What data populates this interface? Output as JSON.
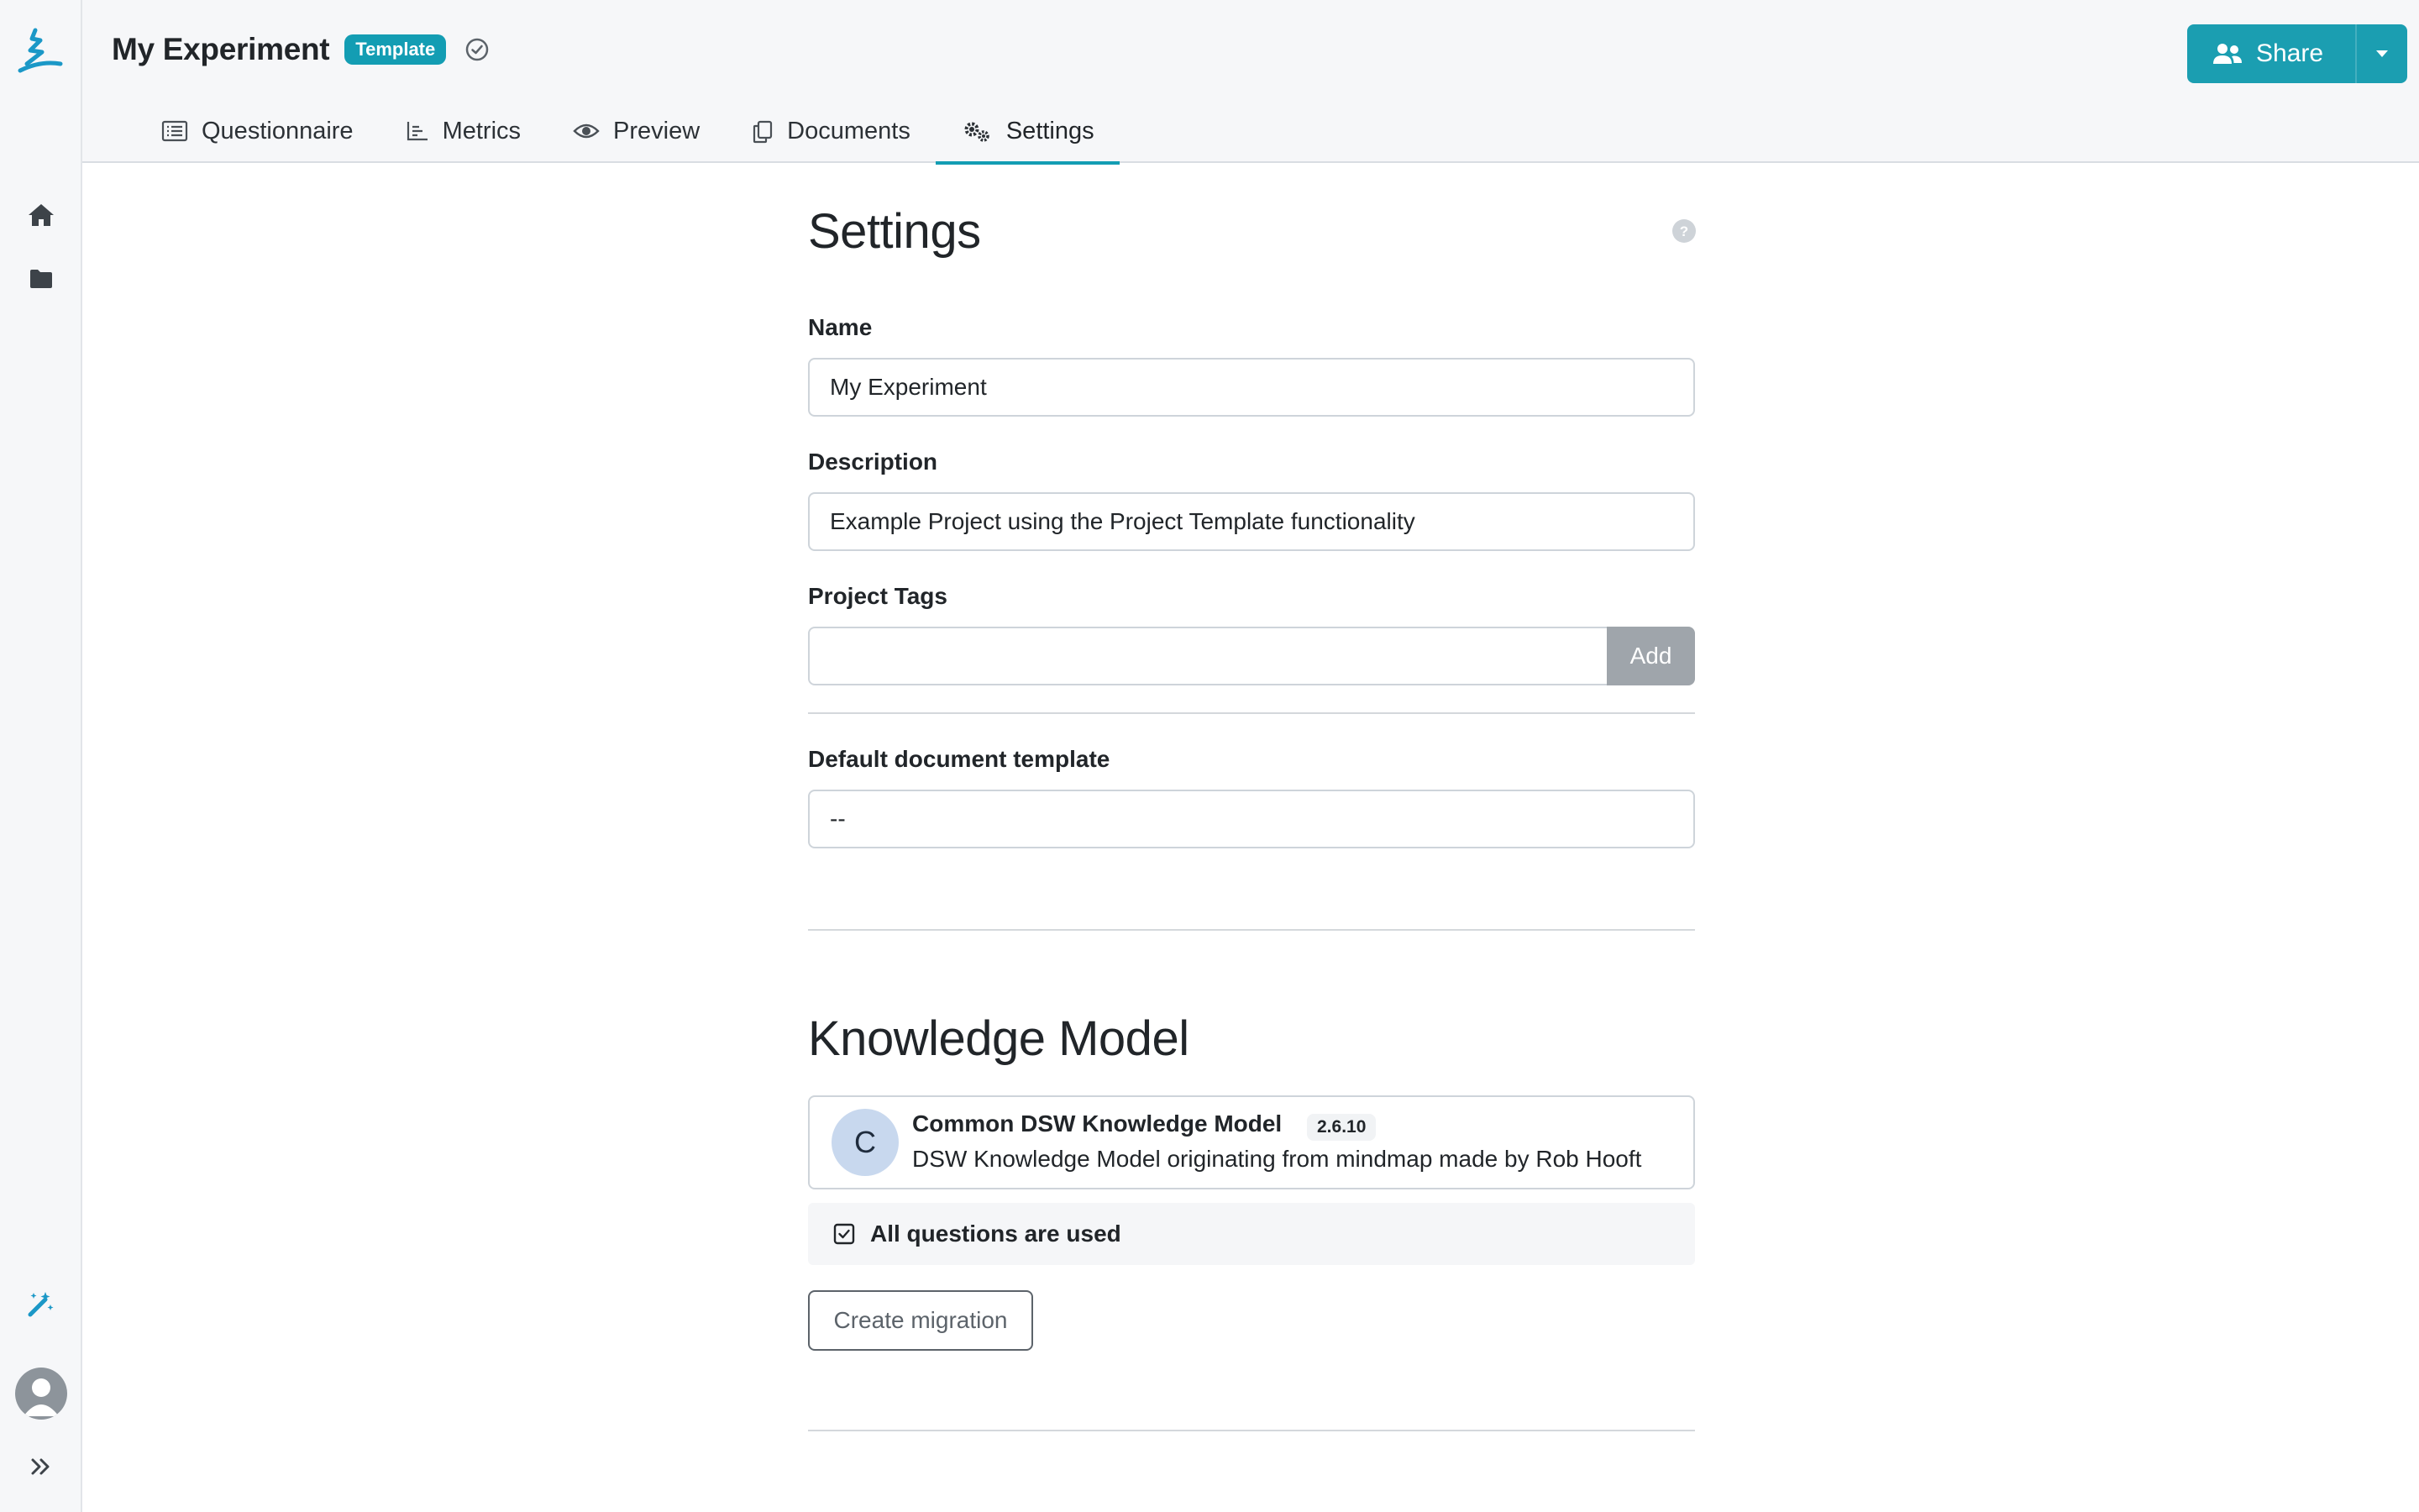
{
  "header": {
    "project_title": "My Experiment",
    "template_badge": "Template",
    "share_label": "Share"
  },
  "tabs": [
    {
      "label": "Questionnaire",
      "icon": "list-icon"
    },
    {
      "label": "Metrics",
      "icon": "bar-chart-icon"
    },
    {
      "label": "Preview",
      "icon": "eye-icon"
    },
    {
      "label": "Documents",
      "icon": "copy-icon"
    },
    {
      "label": "Settings",
      "icon": "gears-icon",
      "active": true
    }
  ],
  "settings": {
    "heading": "Settings",
    "name_label": "Name",
    "name_value": "My Experiment",
    "description_label": "Description",
    "description_value": "Example Project using the Project Template functionality",
    "tags_label": "Project Tags",
    "tags_value": "",
    "add_label": "Add",
    "doc_template_label": "Default document template",
    "doc_template_value": "--"
  },
  "knowledge_model": {
    "heading": "Knowledge Model",
    "avatar_letter": "C",
    "name": "Common DSW Knowledge Model",
    "version": "2.6.10",
    "description": "DSW Knowledge Model originating from mindmap made by Rob Hooft",
    "all_questions": "All questions are used",
    "migration_label": "Create migration"
  },
  "colors": {
    "accent": "#139db3",
    "sidebar_bg": "#f6f7f9",
    "add_button": "#9fa5ab"
  }
}
